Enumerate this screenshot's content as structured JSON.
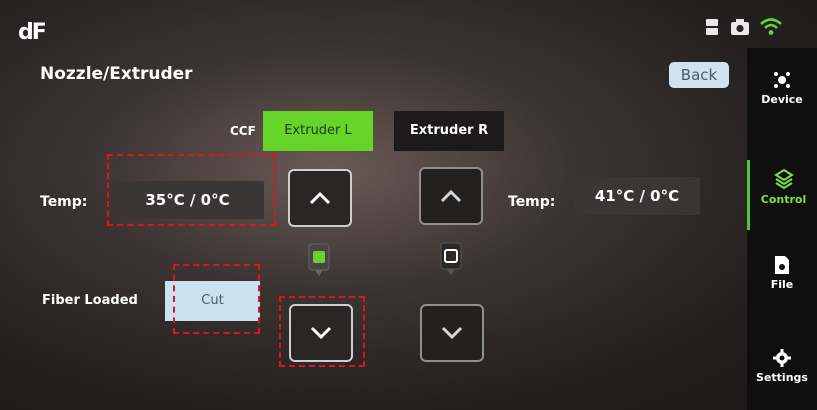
{
  "logo": "dF",
  "page": {
    "title": "Nozzle/Extruder",
    "back_label": "Back"
  },
  "status_icons": [
    "storage-icon",
    "camera-icon",
    "wifi-icon"
  ],
  "extruder": {
    "ccf_label": "CCF",
    "left_tab": "Extruder L",
    "right_tab": "Extruder R",
    "left_temp_label": "Temp:",
    "left_temp_value": "35°C / 0°C",
    "right_temp_label": "Temp:",
    "right_temp_value": "41°C / 0°C",
    "fiber_label": "Fiber Loaded",
    "cut_label": "Cut"
  },
  "sidebar": {
    "items": [
      {
        "label": "Device",
        "icon": "device-icon",
        "active": false
      },
      {
        "label": "Control",
        "icon": "control-icon",
        "active": true
      },
      {
        "label": "File",
        "icon": "file-icon",
        "active": false
      },
      {
        "label": "Settings",
        "icon": "gear-icon",
        "active": false
      }
    ]
  },
  "colors": {
    "active_green": "#66d428",
    "highlight_red": "#e0121b",
    "button_blue": "#c9e1f1"
  }
}
